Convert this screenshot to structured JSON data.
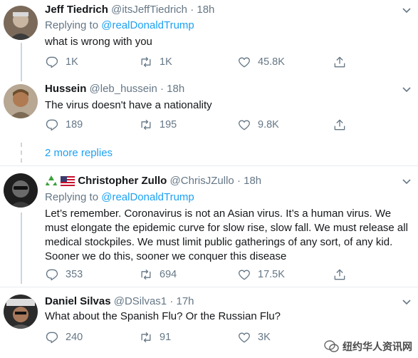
{
  "tweets": [
    {
      "name": "Jeff Tiedrich",
      "handle": "@itsJeffTiedrich",
      "time": "18h",
      "replying_prefix": "Replying to",
      "replying_to": "@realDonaldTrump",
      "text": "what is wrong with you",
      "replies": "1K",
      "retweets": "1K",
      "likes": "45.8K"
    },
    {
      "name": "Hussein",
      "handle": "@leb_hussein",
      "time": "18h",
      "text": "The virus doesn't have a nationality",
      "replies": "189",
      "retweets": "195",
      "likes": "9.8K"
    },
    {
      "name": "Christopher Zullo",
      "handle": "@ChrisJZullo",
      "time": "18h",
      "replying_prefix": "Replying to",
      "replying_to": "@realDonaldTrump",
      "text": "Let’s remember. Coronavirus is not an Asian virus. It’s a human virus. We must elongate the epidemic curve for slow rise, slow fall. We must release all medical stockpiles. We must limit public gatherings of any sort, of any kid. Sooner we do this, sooner we conquer this disease",
      "replies": "353",
      "retweets": "694",
      "likes": "17.5K"
    },
    {
      "name": "Daniel Silvas",
      "handle": "@DSilvas1",
      "time": "17h",
      "text": "What about the Spanish Flu? Or the Russian Flu?",
      "replies": "240",
      "retweets": "91",
      "likes": "3K"
    }
  ],
  "more_replies": "2 more replies",
  "separator": "·",
  "watermark": "纽约华人资讯网",
  "icons": {
    "reply": "reply-icon",
    "retweet": "retweet-icon",
    "like": "heart-icon",
    "share": "share-icon",
    "caret": "chevron-down-icon",
    "name_emoji": [
      "recycle-icon",
      "us-flag-icon"
    ]
  },
  "colors": {
    "link": "#1da1f2",
    "secondary": "#657786",
    "text": "#14171a",
    "line": "#ccd6dd"
  }
}
